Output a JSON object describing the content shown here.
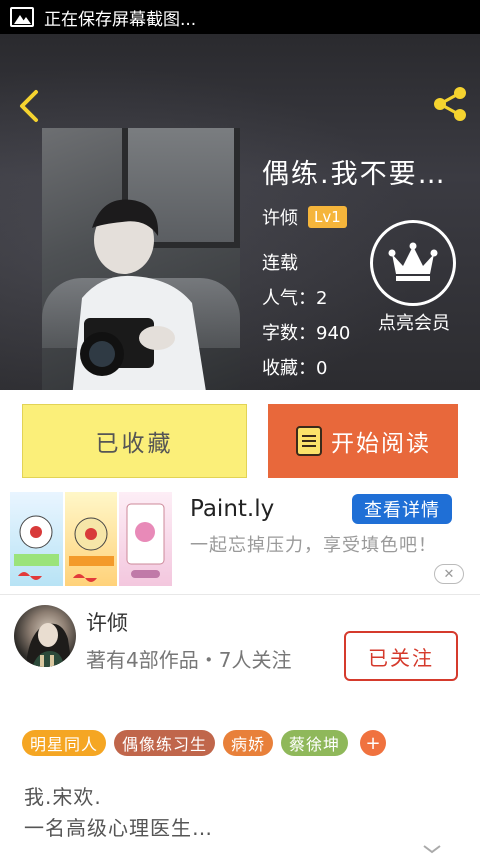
{
  "status_bar": {
    "text": "正在保存屏幕截图..."
  },
  "book": {
    "title": "偶练.我不要…",
    "author": "许倾",
    "level": "Lv1",
    "status": "连载",
    "popularity_label": "人气：",
    "popularity": "2",
    "words_label": "字数：",
    "words": "940",
    "favorites_label": "收藏：",
    "favorites": "0",
    "vip_label": "点亮会员"
  },
  "actions": {
    "favorite_label": "已收藏",
    "read_label": "开始阅读"
  },
  "ad": {
    "title": "Paint.ly",
    "button_label": "查看详情",
    "description": "一起忘掉压力，享受填色吧！",
    "close_label": "✕"
  },
  "author_card": {
    "name": "许倾",
    "works": "著有4部作品・7人关注",
    "follow_label": "已关注"
  },
  "tags": [
    {
      "label": "明星同人",
      "color": "#f5a623"
    },
    {
      "label": "偶像练习生",
      "color": "#c0664b"
    },
    {
      "label": "病娇",
      "color": "#e8803a"
    },
    {
      "label": "蔡徐坤",
      "color": "#8fb85a"
    }
  ],
  "tag_add_label": "+",
  "intro": {
    "line1": "我.宋欢.",
    "line2": "一名高级心理医生…"
  },
  "colors": {
    "accent_yellow": "#f5d32f",
    "read_orange": "#e8683b",
    "follow_red": "#d53a2c",
    "ad_blue": "#1f6fd6"
  },
  "icons": {
    "back": "back-chevron-icon",
    "share": "share-icon",
    "vip": "crown-icon",
    "book": "book-icon",
    "close": "close-icon",
    "expand": "chevron-down-icon"
  }
}
